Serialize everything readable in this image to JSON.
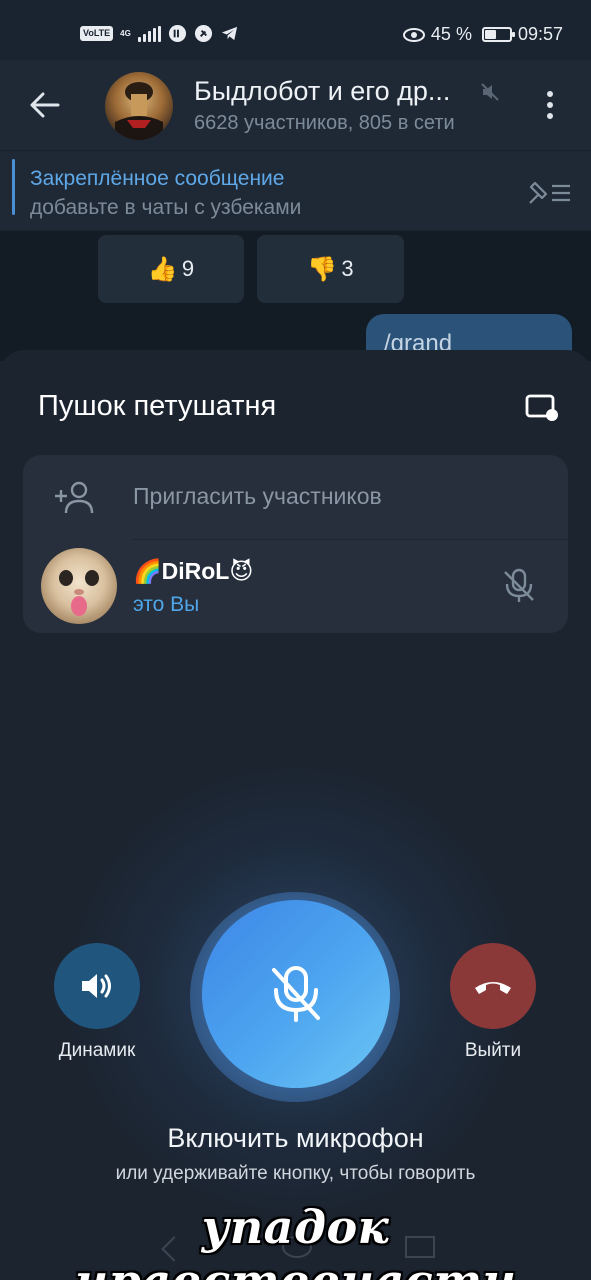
{
  "status_bar": {
    "volte": "VoLTE",
    "network": "4G",
    "battery_percent": "45 %",
    "battery_level": 0.45,
    "time": "09:57"
  },
  "header": {
    "title": "Быдлобот и его др...",
    "subtitle": "6628 участников, 805 в сети",
    "icons": [
      "back-arrow-icon",
      "muted-icon",
      "more-vertical-icon"
    ]
  },
  "pinned": {
    "title": "Закреплённое сообщение",
    "text": "добавьте в чаты с узбеками"
  },
  "chat": {
    "reactions": [
      {
        "emoji": "👍",
        "count": "9"
      },
      {
        "emoji": "👎",
        "count": "3"
      }
    ],
    "outgoing_preview": "/grand"
  },
  "voice_chat": {
    "title": "Пушок петушатня",
    "invite_label": "Пригласить участников",
    "participants": [
      {
        "name": "🌈DiRoL😈",
        "status": "это Вы",
        "muted": true
      }
    ],
    "speaker_label": "Динамик",
    "leave_label": "Выйти",
    "mic_hint_title": "Включить микрофон",
    "mic_hint_subtitle": "или удерживайте кнопку, чтобы говорить"
  },
  "caption": "упадок нравственасти",
  "colors": {
    "background": "#1c2430",
    "accent_blue": "#4fa6e8",
    "speaker_button": "#20567e",
    "leave_button": "#8b3839"
  }
}
